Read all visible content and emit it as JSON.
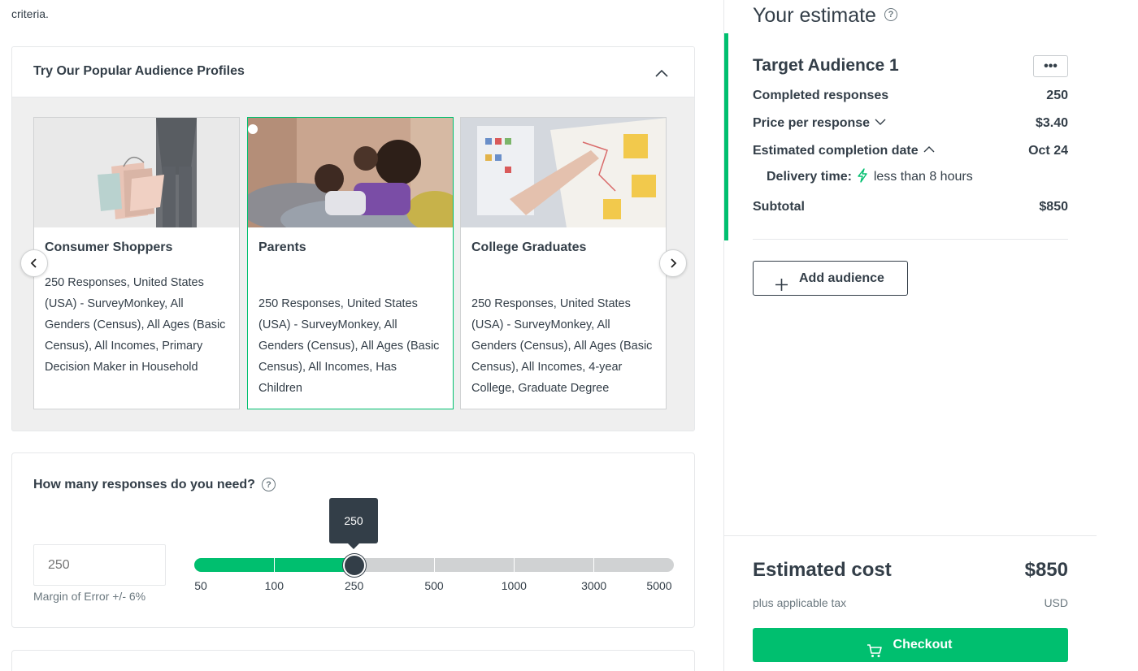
{
  "left": {
    "criteria_text": "criteria.",
    "profiles": {
      "title": "Try Our Popular Audience Profiles",
      "cards": [
        {
          "title": "Consumer Shoppers",
          "description": "250 Responses, United States (USA) - SurveyMonkey, All Genders (Census), All Ages (Basic Census), All Incomes, Primary Decision Maker in Household",
          "selected": false
        },
        {
          "title": "Parents",
          "description": "250 Responses, United States (USA) - SurveyMonkey, All Genders (Census), All Ages (Basic Census), All Incomes, Has Children",
          "selected": true
        },
        {
          "title": "College Graduates",
          "description": "250 Responses, United States (USA) - SurveyMonkey, All Genders (Census), All Ages (Basic Census), All Incomes, 4-year College, Graduate Degree",
          "selected": false
        }
      ]
    },
    "responses": {
      "title": "How many responses do you need?",
      "input_placeholder": "250",
      "margin_of_error": "Margin of Error +/- 6%",
      "slider": {
        "ticks": [
          "50",
          "100",
          "250",
          "500",
          "1000",
          "3000",
          "5000"
        ],
        "selected_value": "250",
        "selected_index": 2
      }
    }
  },
  "right": {
    "title": "Your estimate",
    "audience": {
      "title": "Target Audience 1",
      "more_label": "•••",
      "completed_label": "Completed responses",
      "completed_value": "250",
      "price_label": "Price per response",
      "price_value": "$3.40",
      "date_label": "Estimated completion date",
      "date_value": "Oct 24",
      "delivery_label": "Delivery time:",
      "delivery_value": "less than 8 hours",
      "subtotal_label": "Subtotal",
      "subtotal_value": "$850"
    },
    "add_audience_label": "Add audience",
    "cost": {
      "label": "Estimated cost",
      "value": "$850",
      "tax_note": "plus applicable tax",
      "currency": "USD"
    },
    "checkout_label": "Checkout"
  },
  "colors": {
    "accent": "#00bf6f",
    "text": "#333e48",
    "muted": "#6b787f",
    "border": "#e6e8ea"
  }
}
